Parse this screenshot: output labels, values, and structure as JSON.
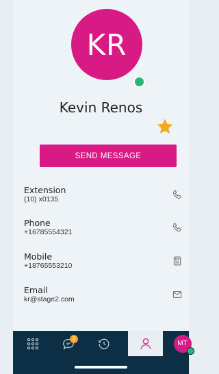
{
  "contact": {
    "initials": "KR",
    "name": "Kevin Renos",
    "presence": "online",
    "favorite": true
  },
  "actions": {
    "send_message_label": "SEND MESSAGE"
  },
  "fields": {
    "extension": {
      "label": "Extension",
      "value": "(10) x0135",
      "icon": "phone-icon"
    },
    "phone": {
      "label": "Phone",
      "value": "+16785554321",
      "icon": "phone-icon"
    },
    "mobile": {
      "label": "Mobile",
      "value": "+18765553210",
      "icon": "calculator-icon"
    },
    "email": {
      "label": "Email",
      "value": "kr@stage2.com",
      "icon": "mail-icon"
    }
  },
  "tabbar": {
    "chat_badge": "1",
    "me_initials": "MT",
    "active_tab": "contacts"
  },
  "colors": {
    "accent": "#d81b84",
    "presence": "#2bb673",
    "star": "#f5a623",
    "tabbar": "#0d2f45",
    "background": "#eef3f7"
  }
}
